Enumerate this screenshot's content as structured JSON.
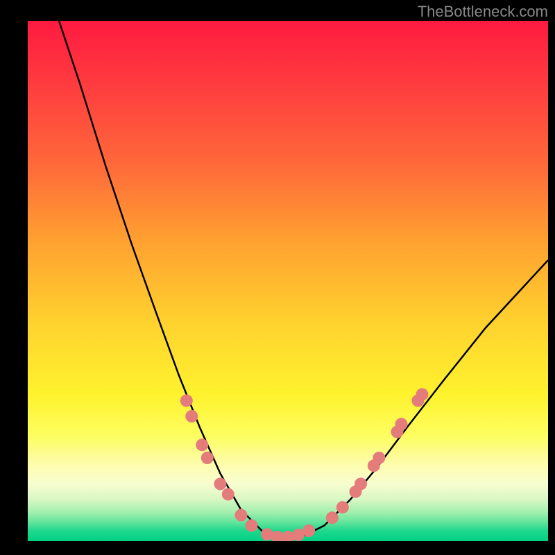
{
  "watermark": "TheBottleneck.com",
  "chart_data": {
    "type": "line",
    "title": "",
    "xlabel": "",
    "ylabel": "",
    "xlim": [
      0,
      100
    ],
    "ylim": [
      0,
      100
    ],
    "curve": {
      "name": "bottleneck-curve",
      "color": "#000000",
      "points": [
        {
          "x": 6,
          "y": 100
        },
        {
          "x": 10,
          "y": 88
        },
        {
          "x": 15,
          "y": 72
        },
        {
          "x": 20,
          "y": 57
        },
        {
          "x": 25,
          "y": 43
        },
        {
          "x": 29,
          "y": 32
        },
        {
          "x": 33,
          "y": 22
        },
        {
          "x": 37,
          "y": 13
        },
        {
          "x": 41,
          "y": 6
        },
        {
          "x": 45,
          "y": 2
        },
        {
          "x": 49,
          "y": 0.5
        },
        {
          "x": 53,
          "y": 1
        },
        {
          "x": 57,
          "y": 3
        },
        {
          "x": 62,
          "y": 8
        },
        {
          "x": 67,
          "y": 14
        },
        {
          "x": 73,
          "y": 22
        },
        {
          "x": 80,
          "y": 31
        },
        {
          "x": 88,
          "y": 41
        },
        {
          "x": 100,
          "y": 54
        }
      ]
    },
    "markers": {
      "color": "#e47c7c",
      "radius": 9,
      "points": [
        {
          "x": 30.5,
          "y": 27
        },
        {
          "x": 31.5,
          "y": 24
        },
        {
          "x": 33.5,
          "y": 18.5
        },
        {
          "x": 34.5,
          "y": 16
        },
        {
          "x": 37,
          "y": 11
        },
        {
          "x": 38.5,
          "y": 9
        },
        {
          "x": 41,
          "y": 5
        },
        {
          "x": 43,
          "y": 3
        },
        {
          "x": 46,
          "y": 1.3
        },
        {
          "x": 48,
          "y": 0.8
        },
        {
          "x": 50,
          "y": 0.8
        },
        {
          "x": 52,
          "y": 1.2
        },
        {
          "x": 54,
          "y": 2
        },
        {
          "x": 58.5,
          "y": 4.5
        },
        {
          "x": 60.5,
          "y": 6.5
        },
        {
          "x": 63,
          "y": 9.5
        },
        {
          "x": 64,
          "y": 11
        },
        {
          "x": 66.5,
          "y": 14.5
        },
        {
          "x": 67.5,
          "y": 16
        },
        {
          "x": 71,
          "y": 21
        },
        {
          "x": 71.8,
          "y": 22.5
        },
        {
          "x": 75,
          "y": 27
        },
        {
          "x": 75.8,
          "y": 28.2
        }
      ]
    }
  }
}
